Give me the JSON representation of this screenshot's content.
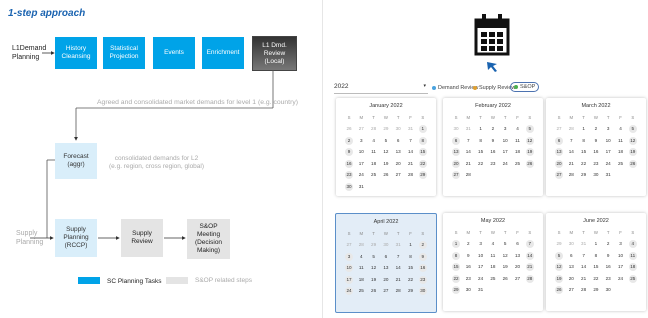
{
  "title": "1-step approach",
  "flow": {
    "row1_label": "L1Demand\nPlanning",
    "row2_label": "Supply\nPlanning",
    "boxes": {
      "history": "History\nCleansing",
      "statistical": "Statistical\nProjection",
      "events": "Events",
      "enrichment": "Enrichment",
      "review": "L1 Dmd.\nReview\n(Local)",
      "forecast": "Forecast\n(aggr)",
      "rccp": "Supply\nPlanning\n(RCCP)",
      "supply_review": "Supply\nReview",
      "sop": "S&OP\nMeeting\n(Decision\nMaking)"
    },
    "note_agreed": "Agreed and consolidated market demands for level 1 (e.g. country)",
    "note_consolidated": "consolidated demands for L2\n(e.g. region, cross region, global)",
    "legend_sc": "SC Planning Tasks",
    "legend_sop": "S&OP related steps"
  },
  "calendar": {
    "year": "2022",
    "legend": [
      "Demand Review",
      "Supply Review",
      "S&OP"
    ],
    "legend_colors": [
      "#4aa3df",
      "#e0a030",
      "#4caf50"
    ],
    "weekdays": [
      "S",
      "M",
      "T",
      "W",
      "T",
      "F",
      "S"
    ],
    "months": [
      {
        "name": "January 2022",
        "wk": [
          "",
          "",
          "",
          "",
          "",
          "",
          ""
        ]
      },
      {
        "name": "February 2022"
      },
      {
        "name": "March 2022"
      },
      {
        "name": "April 2022"
      },
      {
        "name": "May 2022"
      },
      {
        "name": "June 2022"
      }
    ]
  }
}
